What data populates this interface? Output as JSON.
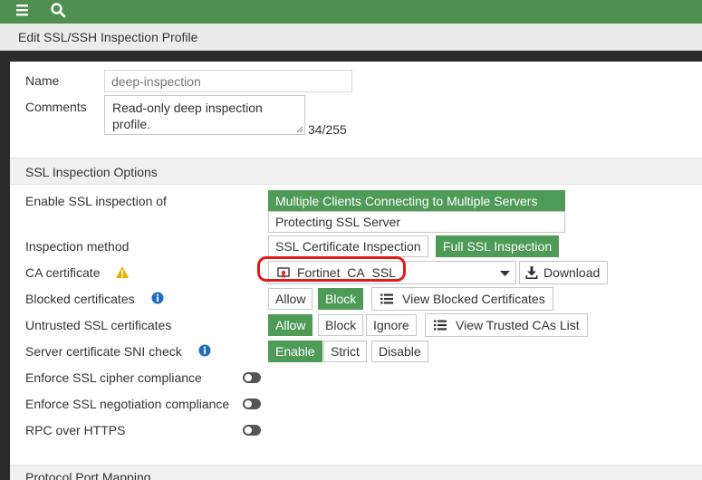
{
  "topbar": {
    "menu_icon": "hamburger-menu-icon",
    "search_icon": "search-icon",
    "color": "#4f8f4f"
  },
  "title": "Edit SSL/SSH Inspection Profile",
  "name": {
    "label": "Name",
    "placeholder": "deep-inspection"
  },
  "comments": {
    "label": "Comments",
    "value": "Read-only deep inspection profile.",
    "counter": "34/255"
  },
  "ssl_section": {
    "title": "SSL Inspection Options",
    "enable_label": "Enable SSL inspection of",
    "enable_options": [
      "Multiple Clients Connecting to Multiple Servers",
      "Protecting SSL Server"
    ],
    "enable_selected": "Multiple Clients Connecting to Multiple Servers",
    "method_label": "Inspection method",
    "method_options": [
      "SSL Certificate Inspection",
      "Full SSL Inspection"
    ],
    "method_selected": "Full SSL Inspection",
    "ca_label": "CA certificate",
    "ca_value": "Fortinet_CA_SSL",
    "download_label": "Download",
    "blocked_label": "Blocked certificates",
    "blocked_options": [
      "Allow",
      "Block"
    ],
    "blocked_selected": "Block",
    "view_blocked_label": "View Blocked Certificates",
    "untrusted_label": "Untrusted SSL certificates",
    "untrusted_options": [
      "Allow",
      "Block",
      "Ignore"
    ],
    "untrusted_selected": "Allow",
    "view_trusted_label": "View Trusted CAs List",
    "sni_label": "Server certificate SNI check",
    "sni_options": [
      "Enable",
      "Strict",
      "Disable"
    ],
    "sni_selected": "Enable",
    "cipher_label": "Enforce SSL cipher compliance",
    "cipher_enabled": false,
    "negotiation_label": "Enforce SSL negotiation compliance",
    "negotiation_enabled": false,
    "rpc_label": "RPC over HTTPS",
    "rpc_enabled": false
  },
  "port_section": {
    "title": "Protocol Port Mapping"
  },
  "colors": {
    "accent": "#4e9a57",
    "highlight": "#e11a1a",
    "warning": "#e5b100",
    "info": "#1e6fc0"
  }
}
